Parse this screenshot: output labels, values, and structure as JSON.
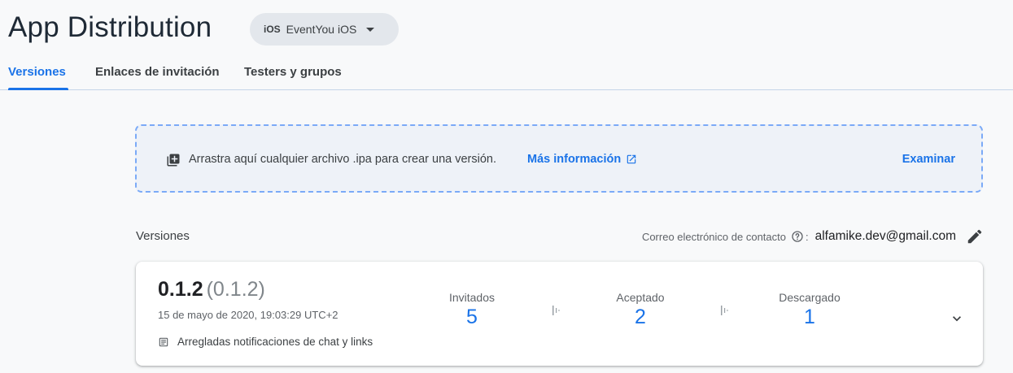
{
  "header": {
    "title": "App Distribution",
    "app_selector": {
      "platform": "iOS",
      "app_name": "EventYou iOS"
    },
    "tabs": [
      {
        "label": "Versiones",
        "active": true
      },
      {
        "label": "Enlaces de invitación",
        "active": false
      },
      {
        "label": "Testers y grupos",
        "active": false
      }
    ]
  },
  "upload": {
    "text": "Arrastra aquí cualquier archivo .ipa para crear una versión.",
    "learn_more": "Más información",
    "browse": "Examinar"
  },
  "releases": {
    "section_label": "Versiones",
    "contact_label": "Correo electrónico de contacto",
    "colon": ":",
    "contact_email": "alfamike.dev@gmail.com",
    "items": [
      {
        "version": "0.1.2",
        "build": "(0.1.2)",
        "date": "15 de mayo de 2020, 19:03:29 UTC+2",
        "notes": "Arregladas notificaciones de chat y links",
        "stats": [
          {
            "label": "Invitados",
            "value": "5"
          },
          {
            "label": "Aceptado",
            "value": "2"
          },
          {
            "label": "Descargado",
            "value": "1"
          }
        ]
      }
    ]
  },
  "colors": {
    "accent": "#1a73e8",
    "background": "#f8f9fa",
    "dropzone_border": "#7baaf7"
  },
  "icons": [
    "add-box-icon",
    "external-link-icon",
    "help-icon",
    "edit-icon",
    "notes-icon",
    "funnel-separator-icon",
    "chevron-down-icon",
    "dropdown-caret-icon"
  ]
}
